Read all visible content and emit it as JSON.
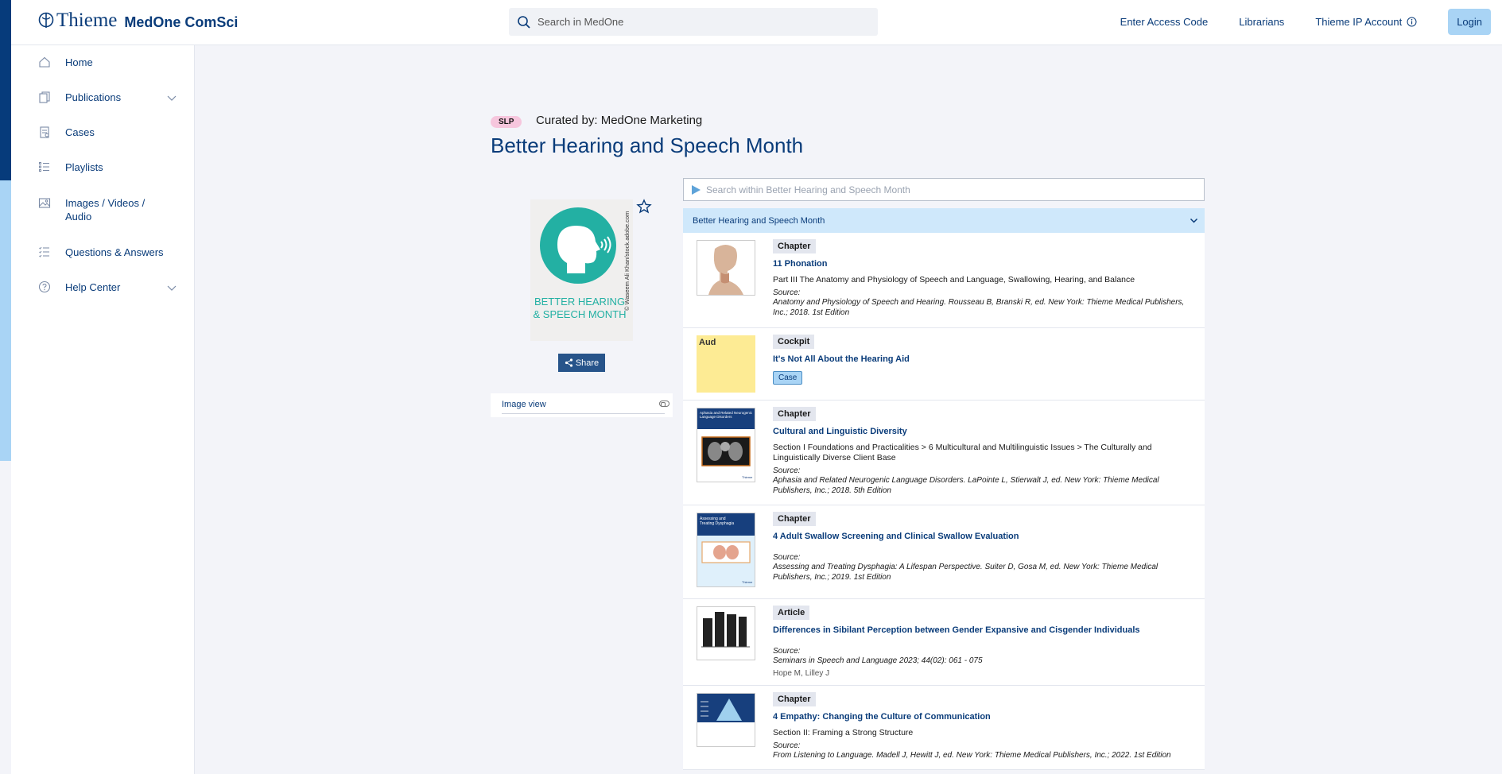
{
  "header": {
    "brand": "Thieme",
    "product": "MedOne ComSci",
    "search_placeholder": "Search in MedOne",
    "nav": [
      "Enter Access Code",
      "Librarians",
      "Thieme IP Account"
    ],
    "login": "Login"
  },
  "sidebar": {
    "items": [
      {
        "label": "Home",
        "icon": "home-icon"
      },
      {
        "label": "Publications",
        "icon": "publications-icon",
        "expandable": true
      },
      {
        "label": "Cases",
        "icon": "cases-icon"
      },
      {
        "label": "Playlists",
        "icon": "playlist-icon"
      },
      {
        "label": "Images / Videos / Audio",
        "icon": "media-icon"
      },
      {
        "label": "Questions & Answers",
        "icon": "qa-icon"
      },
      {
        "label": "Help Center",
        "icon": "help-icon",
        "expandable": true
      }
    ]
  },
  "playlist": {
    "tag": "SLP",
    "curated": "Curated by: MedOne Marketing",
    "title": "Better Hearing and Speech Month",
    "cover_text_line1": "BETTER HEARING",
    "cover_text_line2": "& SPEECH MONTH",
    "cover_credit": "© Waseem Ali Khan/stock.adobe.com",
    "share": "Share",
    "image_view": "Image view",
    "search_placeholder": "Search within Better Hearing and Speech Month",
    "list_header": "Better Hearing and Speech Month"
  },
  "results": [
    {
      "type": "Chapter",
      "title": "11 Phonation",
      "path": "Part III The Anatomy and Physiology of Speech and Language, Swallowing, Hearing, and Balance",
      "source_label": "Source:",
      "source": "Anatomy and Physiology of Speech and Hearing. Rousseau B, Branski R, ed. New York: Thieme Medical Publishers, Inc.; 2018. 1st Edition",
      "thumb": "head-anatomy"
    },
    {
      "type": "Cockpit",
      "title": "It's Not All About the Hearing Aid",
      "badge": "Case",
      "thumb_label": "Aud",
      "thumb": "aud-note"
    },
    {
      "type": "Chapter",
      "title": "Cultural and Linguistic Diversity",
      "path": "Section I Foundations and Practicalities > 6 Multicultural and Multilinguistic Issues > The Culturally and Linguistically Diverse Client Base",
      "source_label": "Source:",
      "source": "Aphasia and Related Neurogenic Language Disorders. LaPointe L, Stierwalt J, ed. New York: Thieme Medical Publishers, Inc.; 2018. 5th Edition",
      "thumb": "book-aphasia",
      "thumb_title": "Aphasia and Related Neurogenic Language Disorders"
    },
    {
      "type": "Chapter",
      "title": "4 Adult Swallow Screening and Clinical Swallow Evaluation",
      "source_label": "Source:",
      "source": "Assessing and Treating Dysphagia: A Lifespan Perspective. Suiter D, Gosa M, ed. New York: Thieme Medical Publishers, Inc.; 2019. 1st Edition",
      "thumb": "book-dysphagia",
      "thumb_title": "Assessing and Treating Dysphagia"
    },
    {
      "type": "Article",
      "title": "Differences in Sibilant Perception between Gender Expansive and Cisgender Individuals",
      "source_label": "Source:",
      "source": "Seminars in Speech and Language 2023; 44(02): 061 - 075",
      "authors": "Hope M, Lilley J",
      "thumb": "bar-figure"
    },
    {
      "type": "Chapter",
      "title": "4 Empathy: Changing the Culture of Communication",
      "path": "Section II: Framing a Strong Structure",
      "source_label": "Source:",
      "source": "From Listening to Language. Madell J, Hewitt J, ed. New York: Thieme Medical Publishers, Inc.; 2022. 1st Edition",
      "thumb": "pyramid"
    }
  ],
  "colors": {
    "brand_navy": "#0a3c7a",
    "accent_light_blue": "#a9d4f5",
    "tag_pink": "#f6c6dd",
    "cover_teal": "#23b0a3"
  }
}
